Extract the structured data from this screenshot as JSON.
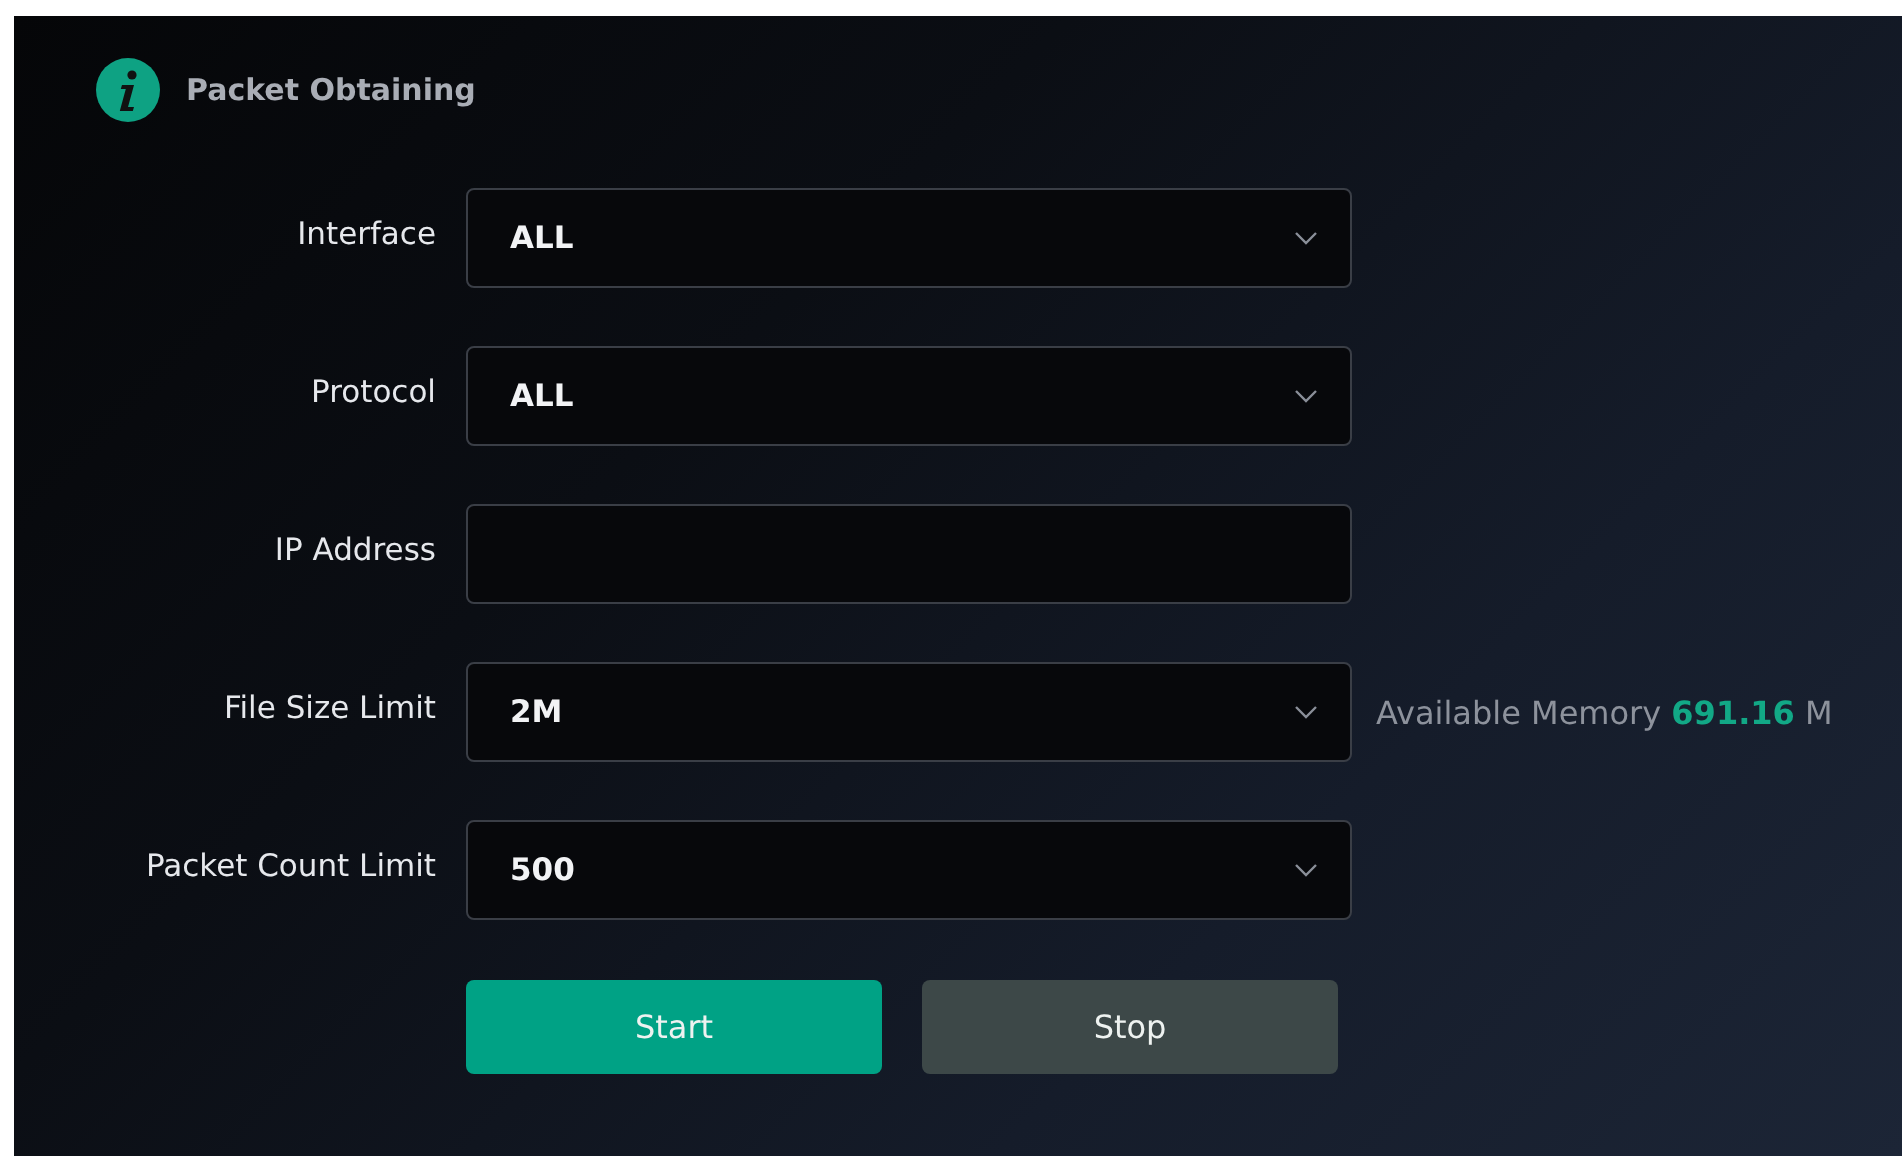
{
  "header": {
    "title": "Packet Obtaining"
  },
  "fields": [
    {
      "label": "Interface",
      "kind": "select",
      "value": "ALL"
    },
    {
      "label": "Protocol",
      "kind": "select",
      "value": "ALL"
    },
    {
      "label": "IP Address",
      "kind": "text"
    },
    {
      "label": "File Size Limit",
      "kind": "select",
      "value": "2M",
      "note": "Available Memory **691.16** M"
    },
    {
      "label": "Packet Count Limit",
      "kind": "select",
      "value": "500"
    }
  ],
  "buttons": [
    {
      "label": "Start",
      "kind": "primary"
    },
    {
      "label": "Stop",
      "kind": "secondary"
    }
  ]
}
